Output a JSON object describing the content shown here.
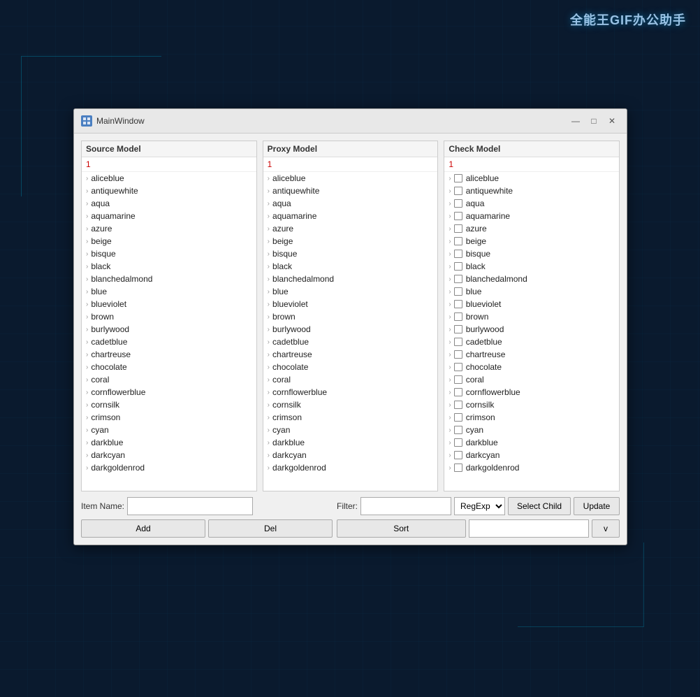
{
  "watermark": "全能王GIF办公助手",
  "window": {
    "title": "MainWindow",
    "icon_label": "M"
  },
  "panels": [
    {
      "id": "source",
      "header": "Source Model",
      "number": "1",
      "items": [
        "aliceblue",
        "antiquewhite",
        "aqua",
        "aquamarine",
        "azure",
        "beige",
        "bisque",
        "black",
        "blanchedalmond",
        "blue",
        "blueviolet",
        "brown",
        "burlywood",
        "cadetblue",
        "chartreuse",
        "chocolate",
        "coral",
        "cornflowerblue",
        "cornsilk",
        "crimson",
        "cyan",
        "darkblue",
        "darkcyan",
        "darkgoldenrod"
      ]
    },
    {
      "id": "proxy",
      "header": "Proxy Model",
      "number": "1",
      "items": [
        "aliceblue",
        "antiquewhite",
        "aqua",
        "aquamarine",
        "azure",
        "beige",
        "bisque",
        "black",
        "blanchedalmond",
        "blue",
        "blueviolet",
        "brown",
        "burlywood",
        "cadetblue",
        "chartreuse",
        "chocolate",
        "coral",
        "cornflowerblue",
        "cornsilk",
        "crimson",
        "cyan",
        "darkblue",
        "darkcyan",
        "darkgoldenrod"
      ]
    },
    {
      "id": "check",
      "header": "Check Model",
      "number": "1",
      "items": [
        "aliceblue",
        "antiquewhite",
        "aqua",
        "aquamarine",
        "azure",
        "beige",
        "bisque",
        "black",
        "blanchedalmond",
        "blue",
        "blueviolet",
        "brown",
        "burlywood",
        "cadetblue",
        "chartreuse",
        "chocolate",
        "coral",
        "cornflowerblue",
        "cornsilk",
        "crimson",
        "cyan",
        "darkblue",
        "darkcyan",
        "darkgoldenrod"
      ]
    }
  ],
  "controls": {
    "item_name_label": "Item Name:",
    "filter_label": "Filter:",
    "filter_placeholder": "",
    "item_name_placeholder": "",
    "regexp_option": "RegExp",
    "add_label": "Add",
    "del_label": "Del",
    "sort_label": "Sort",
    "select_child_label": "Select Child",
    "update_label": "Update",
    "v_label": "v"
  }
}
